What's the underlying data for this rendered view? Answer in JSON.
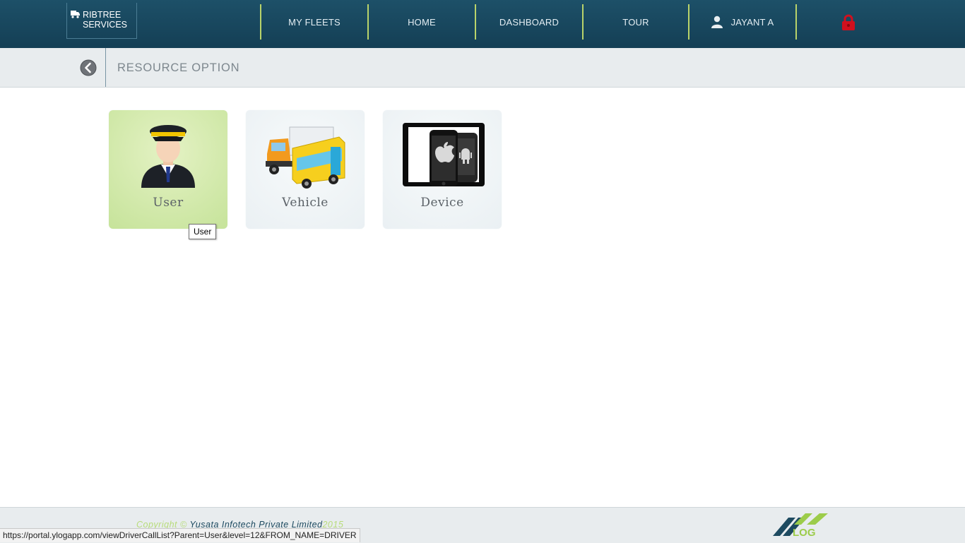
{
  "brand": {
    "line1": "RIBTREE",
    "line2": "SERVICES"
  },
  "nav": {
    "my_fleets": "MY FLEETS",
    "home": "HOME",
    "dashboard": "DASHBOARD",
    "tour": "TOUR",
    "user": "JAYANT A"
  },
  "page": {
    "title": "RESOURCE OPTION"
  },
  "tiles": [
    {
      "label": "User",
      "icon": "driver-icon"
    },
    {
      "label": "Vehicle",
      "icon": "vehicles-icon"
    },
    {
      "label": "Device",
      "icon": "devices-icon"
    }
  ],
  "tooltip": "User",
  "footer": {
    "copy_prefix": "Copyright © ",
    "company": "Yusata Infotech Private Limited",
    "year": "2015",
    "logo_text": "LOG"
  },
  "status_url": "https://portal.ylogapp.com/viewDriverCallList?Parent=User&level=12&FROM_NAME=DRIVER",
  "colors": {
    "header": "#1b4a61",
    "accent": "#b9d36a",
    "active_tile": "#cde7a4",
    "lock": "#d0101e"
  }
}
